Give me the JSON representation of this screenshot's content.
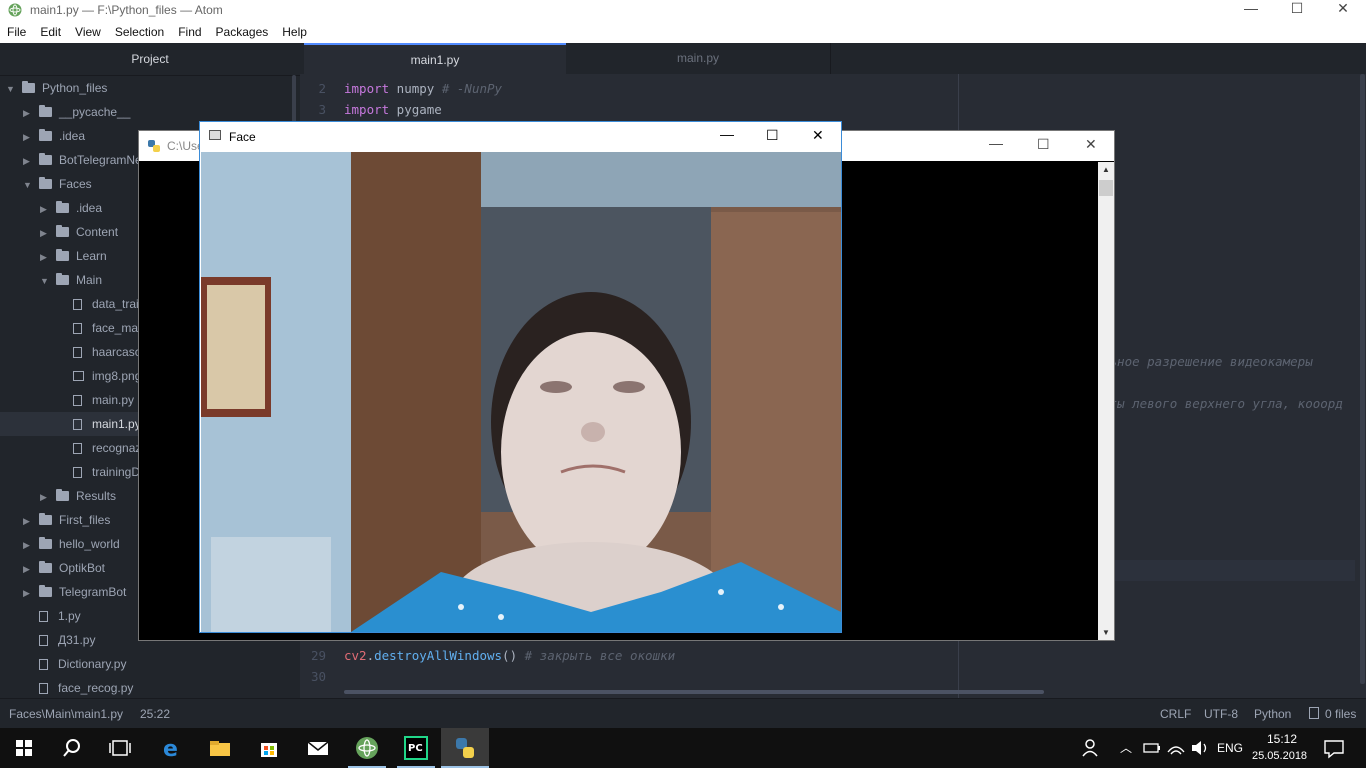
{
  "window": {
    "title": "main1.py — F:\\Python_files — Atom",
    "controls": {
      "minimize": "—",
      "maximize": "☐",
      "close": "✕"
    }
  },
  "menu": [
    "File",
    "Edit",
    "View",
    "Selection",
    "Find",
    "Packages",
    "Help"
  ],
  "tree": {
    "header": "Project",
    "items": [
      {
        "label": "Python_files",
        "type": "folder",
        "open": true
      },
      {
        "label": "__pycache__",
        "type": "folder"
      },
      {
        "label": ".idea",
        "type": "folder"
      },
      {
        "label": "BotTelegramNe",
        "type": "folder"
      },
      {
        "label": "Faces",
        "type": "folder",
        "open": true
      },
      {
        "label": ".idea",
        "type": "folder"
      },
      {
        "label": "Content",
        "type": "folder"
      },
      {
        "label": "Learn",
        "type": "folder"
      },
      {
        "label": "Main",
        "type": "folder",
        "open": true
      },
      {
        "label": "data_train",
        "type": "file"
      },
      {
        "label": "face_main",
        "type": "file"
      },
      {
        "label": "haarcasca",
        "type": "file"
      },
      {
        "label": "img8.png",
        "type": "image"
      },
      {
        "label": "main.py",
        "type": "file"
      },
      {
        "label": "main1.py",
        "type": "file",
        "selected": true
      },
      {
        "label": "recognaz",
        "type": "file"
      },
      {
        "label": "trainingD",
        "type": "file"
      },
      {
        "label": "Results",
        "type": "folder"
      },
      {
        "label": "First_files",
        "type": "folder"
      },
      {
        "label": "hello_world",
        "type": "folder"
      },
      {
        "label": "OptikBot",
        "type": "folder"
      },
      {
        "label": "TelegramBot",
        "type": "folder"
      },
      {
        "label": "1.py",
        "type": "file"
      },
      {
        "label": "Д31.py",
        "type": "file"
      },
      {
        "label": "Dictionary.py",
        "type": "file"
      },
      {
        "label": "face_recog.py",
        "type": "file"
      }
    ]
  },
  "tabs": [
    {
      "label": "main1.py",
      "active": true
    },
    {
      "label": "main.py",
      "active": false
    }
  ],
  "editor": {
    "lines": [
      {
        "num": "2",
        "kw": "import",
        "rest": " numpy ",
        "comment": "# -NunPy"
      },
      {
        "num": "3",
        "kw": "import",
        "rest": " pygame",
        "comment": ""
      },
      {
        "num": "29",
        "obj": "cv2",
        "dot": ".",
        "fn": "destroyAllWindows",
        "rest": "() ",
        "comment": "# закрыть все окошки"
      },
      {
        "num": "30"
      }
    ],
    "comment_right_1": "льное разрешение видеокамеры",
    "comment_right_2": "аты левого верхнего угла, кооорд"
  },
  "console_window": {
    "title": "C:\\Use"
  },
  "face_window": {
    "title": "Face"
  },
  "status": {
    "path": "Faces\\Main\\main1.py",
    "cursor": "25:22",
    "line_ending": "CRLF",
    "encoding": "UTF-8",
    "grammar": "Python",
    "files": "0 files"
  },
  "taskbar": {
    "lang": "ENG",
    "time": "15:12",
    "date": "25.05.2018"
  }
}
